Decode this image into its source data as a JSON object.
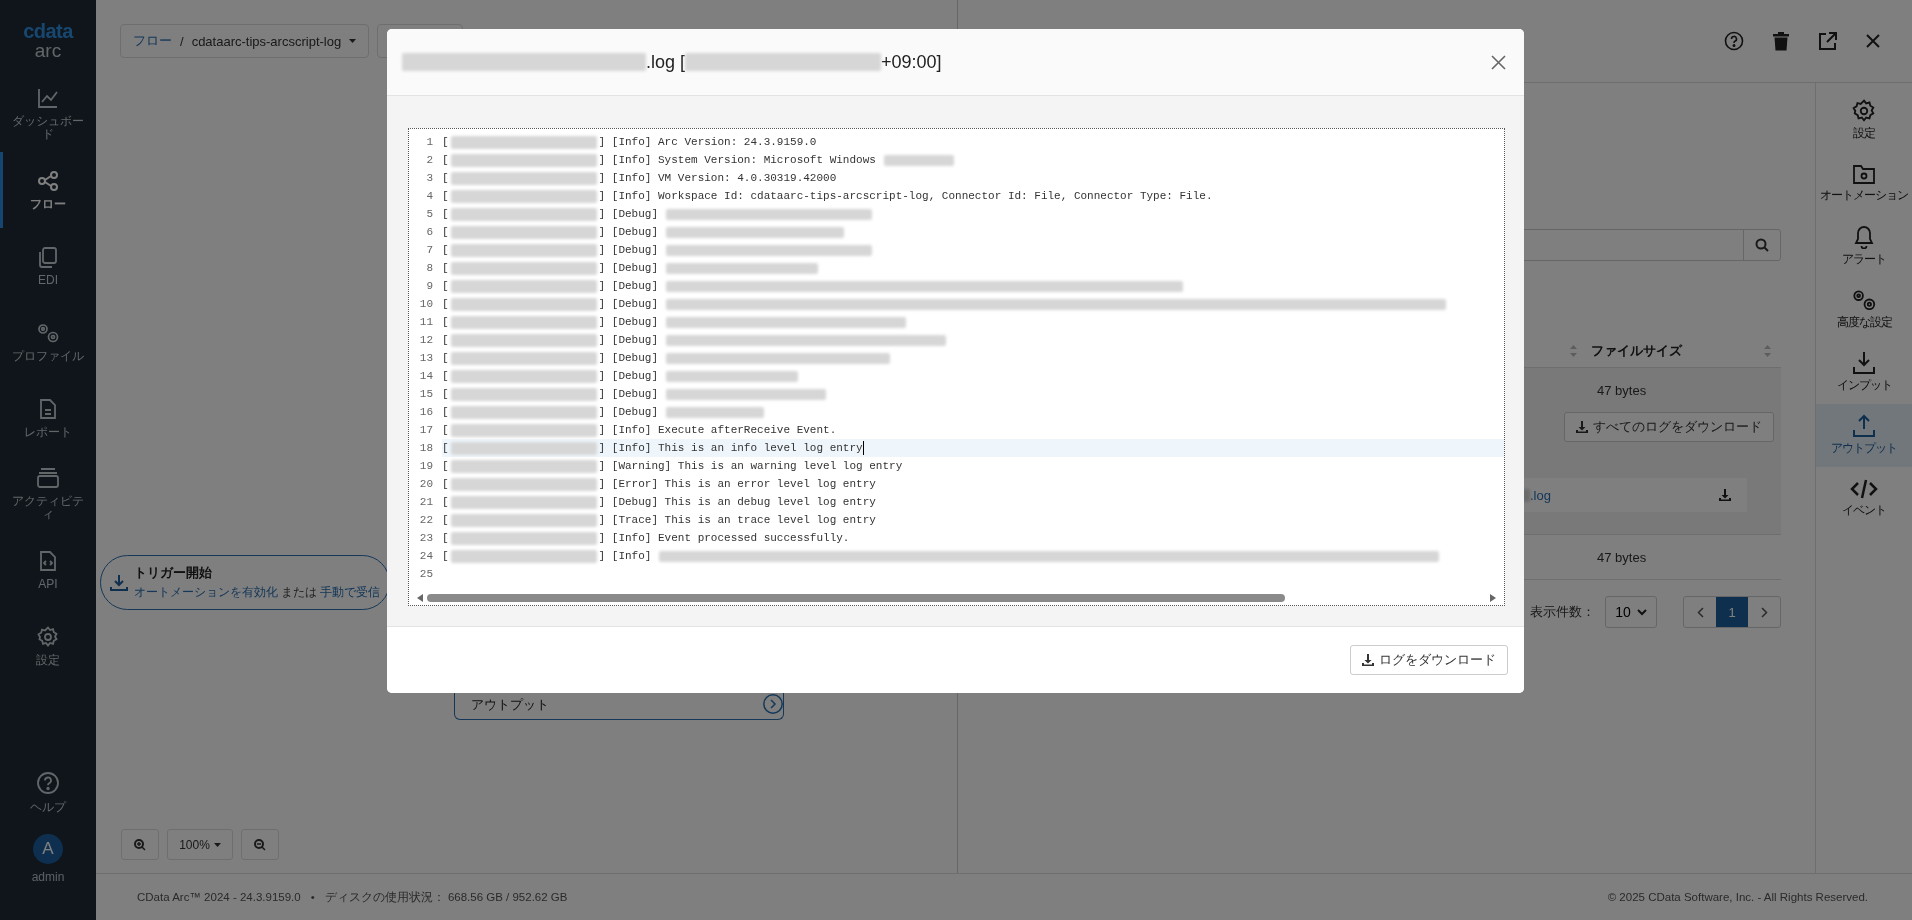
{
  "sidebar": {
    "logo": {
      "brand": "cdata",
      "product": "arc"
    },
    "items": [
      {
        "label": "ダッシュボード",
        "selected": false
      },
      {
        "label": "フロー",
        "selected": true
      },
      {
        "label": "EDI",
        "selected": false
      },
      {
        "label": "プロファイル",
        "selected": false
      },
      {
        "label": "レポート",
        "selected": false
      },
      {
        "label": "アクティビティ",
        "selected": false
      },
      {
        "label": "API",
        "selected": false
      },
      {
        "label": "設定",
        "selected": false
      }
    ],
    "help": {
      "label": "ヘルプ"
    },
    "user": {
      "initial": "A",
      "name": "admin"
    }
  },
  "breadcrumb": {
    "root": "フロー",
    "separator": "/",
    "workspace": "cdataarc-tips-arcscript-log"
  },
  "canvas": {
    "trigger": {
      "title": "トリガー開始",
      "enable_link": "オートメーションを有効化",
      "or": "または",
      "manual_link": "手動で受信"
    },
    "output_node": {
      "label": "アウトプット"
    },
    "zoom_text": "100%"
  },
  "panel": {
    "tabs": [
      {
        "label": "設定",
        "selected": false
      },
      {
        "label": "オートメーション",
        "selected": false
      },
      {
        "label": "アラート",
        "selected": false
      },
      {
        "label": "高度な設定",
        "selected": false
      },
      {
        "label": "インプット",
        "selected": false
      },
      {
        "label": "アウトプット",
        "selected": true
      },
      {
        "label": "イベント",
        "selected": false
      }
    ],
    "table": {
      "size_header": "ファイルサイズ",
      "rows": [
        {
          "size": "47 bytes",
          "download_all": "すべてのログをダウンロード",
          "files": [
            {
              "name": ".log",
              "name_redacted": true
            }
          ]
        },
        {
          "size": "47 bytes"
        }
      ]
    },
    "pagination": {
      "page_size_label": "表示件数：",
      "page_size": "10",
      "pages": [
        {
          "label": "1",
          "selected": true
        }
      ]
    }
  },
  "footer": {
    "version": "CData Arc™ 2024 - 24.3.9159.0",
    "separator": "•",
    "disk": "ディスクの使用状況： 668.56 GB / 952.62 GB",
    "copyright": "© 2025 CData Software, Inc. - All Rights Reserved."
  },
  "modal": {
    "title": [
      {
        "kind": "redacted"
      },
      {
        "kind": "text",
        "text": ".log ["
      },
      {
        "kind": "redacted"
      },
      {
        "kind": "text",
        "text": "+09:00]"
      }
    ],
    "log_lines": [
      {
        "kind": "entry",
        "number": "1",
        "prefix": "[",
        "text": "] [Info] Arc Version: 24.3.9159.0",
        "redacted_message": false,
        "selected": false
      },
      {
        "kind": "entry",
        "number": "2",
        "prefix": "[",
        "text": "] [Info] System Version: Microsoft Windows",
        "redacted_message": true,
        "selected": false
      },
      {
        "kind": "entry",
        "number": "3",
        "prefix": "[",
        "text": "] [Info] VM Version: 4.0.30319.42000",
        "redacted_message": false,
        "selected": false
      },
      {
        "kind": "entry",
        "number": "4",
        "prefix": "[",
        "text": "] [Info] Workspace Id: cdataarc-tips-arcscript-log, Connector Id: File, Connector Type: File.",
        "redacted_message": false,
        "selected": false
      },
      {
        "kind": "entry",
        "number": "5",
        "prefix": "[",
        "text": "] [Debug]",
        "redacted_message": true,
        "selected": false
      },
      {
        "kind": "entry",
        "number": "6",
        "prefix": "[",
        "text": "] [Debug]",
        "redacted_message": true,
        "selected": false
      },
      {
        "kind": "entry",
        "number": "7",
        "prefix": "[",
        "text": "] [Debug]",
        "redacted_message": true,
        "selected": false
      },
      {
        "kind": "entry",
        "number": "8",
        "prefix": "[",
        "text": "] [Debug]",
        "redacted_message": true,
        "selected": false
      },
      {
        "kind": "entry",
        "number": "9",
        "prefix": "[",
        "text": "] [Debug]",
        "redacted_message": true,
        "selected": false
      },
      {
        "kind": "entry",
        "number": "10",
        "prefix": "[",
        "text": "] [Debug]",
        "redacted_message": true,
        "selected": false
      },
      {
        "kind": "entry",
        "number": "11",
        "prefix": "[",
        "text": "] [Debug]",
        "redacted_message": true,
        "selected": false
      },
      {
        "kind": "entry",
        "number": "12",
        "prefix": "[",
        "text": "] [Debug]",
        "redacted_message": true,
        "selected": false
      },
      {
        "kind": "entry",
        "number": "13",
        "prefix": "[",
        "text": "] [Debug]",
        "redacted_message": true,
        "selected": false
      },
      {
        "kind": "entry",
        "number": "14",
        "prefix": "[",
        "text": "] [Debug]",
        "redacted_message": true,
        "selected": false
      },
      {
        "kind": "entry",
        "number": "15",
        "prefix": "[",
        "text": "] [Debug]",
        "redacted_message": true,
        "selected": false
      },
      {
        "kind": "entry",
        "number": "16",
        "prefix": "[",
        "text": "] [Debug]",
        "redacted_message": true,
        "selected": false
      },
      {
        "kind": "entry",
        "number": "17",
        "prefix": "[",
        "text": "] [Info] Execute afterReceive Event.",
        "redacted_message": false,
        "selected": false
      },
      {
        "kind": "entry",
        "number": "18",
        "prefix": "[",
        "text": "] [Info] This is an info level log entry",
        "redacted_message": false,
        "selected": true
      },
      {
        "kind": "entry",
        "number": "19",
        "prefix": "[",
        "text": "] [Warning] This is an warning level log entry",
        "redacted_message": false,
        "selected": false
      },
      {
        "kind": "entry",
        "number": "20",
        "prefix": "[",
        "text": "] [Error] This is an error level log entry",
        "redacted_message": false,
        "selected": false
      },
      {
        "kind": "entry",
        "number": "21",
        "prefix": "[",
        "text": "] [Debug] This is an debug level log entry",
        "redacted_message": false,
        "selected": false
      },
      {
        "kind": "entry",
        "number": "22",
        "prefix": "[",
        "text": "] [Trace] This is an trace level log entry",
        "redacted_message": false,
        "selected": false
      },
      {
        "kind": "entry",
        "number": "23",
        "prefix": "[",
        "text": "] [Info] Event processed successfully.",
        "redacted_message": false,
        "selected": false
      },
      {
        "kind": "entry",
        "number": "24",
        "prefix": "[",
        "text": "] [Info]",
        "redacted_message": true,
        "selected": false
      },
      {
        "kind": "empty",
        "number": "25",
        "selected": false
      }
    ],
    "download_button": "ログをダウンロード"
  }
}
